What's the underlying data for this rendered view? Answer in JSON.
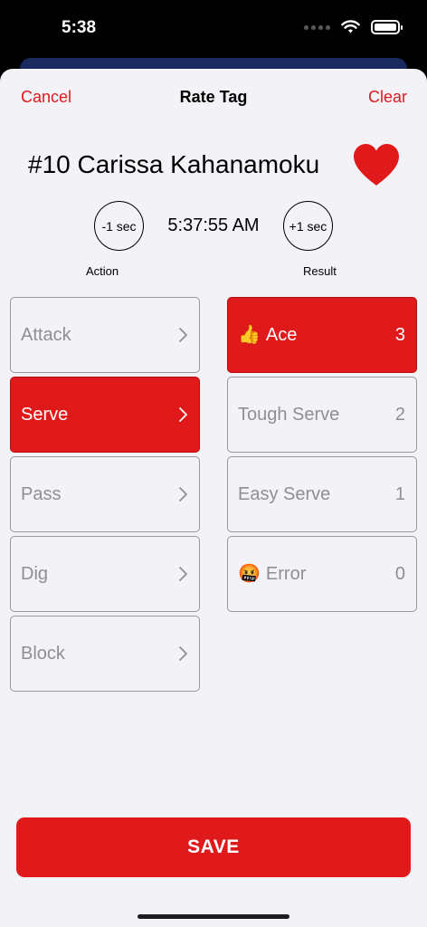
{
  "status": {
    "time": "5:38"
  },
  "nav": {
    "cancel": "Cancel",
    "title": "Rate Tag",
    "clear": "Clear"
  },
  "player": {
    "name": "#10 Carissa Kahanamoku",
    "favorite_color": "#e0191b"
  },
  "timer": {
    "minus_label": "-1 sec",
    "time": "5:37:55 AM",
    "plus_label": "+1 sec"
  },
  "columns": {
    "action_label": "Action",
    "result_label": "Result"
  },
  "actions": [
    {
      "label": "Attack",
      "selected": false
    },
    {
      "label": "Serve",
      "selected": true
    },
    {
      "label": "Pass",
      "selected": false
    },
    {
      "label": "Dig",
      "selected": false
    },
    {
      "label": "Block",
      "selected": false
    }
  ],
  "results": [
    {
      "emoji": "👍",
      "label": "Ace",
      "count": "3",
      "selected": true
    },
    {
      "emoji": "",
      "label": "Tough Serve",
      "count": "2",
      "selected": false
    },
    {
      "emoji": "",
      "label": "Easy Serve",
      "count": "1",
      "selected": false
    },
    {
      "emoji": "🤬",
      "label": "Error",
      "count": "0",
      "selected": false
    }
  ],
  "save_label": "SAVE",
  "colors": {
    "accent": "#e0191b",
    "sheet_bg": "#f2f2f7",
    "inactive_text": "#8e8e93"
  }
}
